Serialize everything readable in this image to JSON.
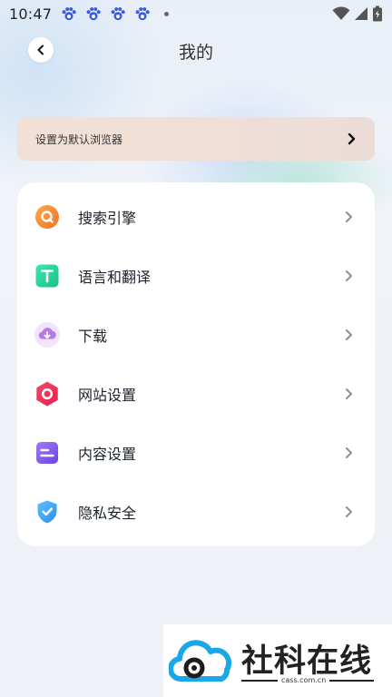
{
  "status_bar": {
    "time": "10:47",
    "notification_icons": [
      "paw-icon",
      "paw-icon",
      "paw-icon",
      "paw-icon"
    ],
    "system_icons": [
      "wifi-icon",
      "signal-icon",
      "battery-icon"
    ]
  },
  "header": {
    "title": "我的",
    "back_icon": "chevron-left-icon"
  },
  "banner": {
    "label": "设置为默认浏览器",
    "arrow_icon": "chevron-right-icon"
  },
  "menu": {
    "items": [
      {
        "label": "搜索引擎",
        "icon": "search-engine-icon",
        "color": "#f5872a"
      },
      {
        "label": "语言和翻译",
        "icon": "translate-icon",
        "color": "#2bd49a"
      },
      {
        "label": "下载",
        "icon": "download-cloud-icon",
        "color": "#b57ae8"
      },
      {
        "label": "网站设置",
        "icon": "website-settings-icon",
        "color": "#f0335c"
      },
      {
        "label": "内容设置",
        "icon": "content-settings-icon",
        "color": "#8a5cf0"
      },
      {
        "label": "隐私安全",
        "icon": "shield-check-icon",
        "color": "#3aa4f5"
      }
    ]
  },
  "watermark": {
    "title": "社科在线",
    "subtitle": "cass.com.cn"
  }
}
